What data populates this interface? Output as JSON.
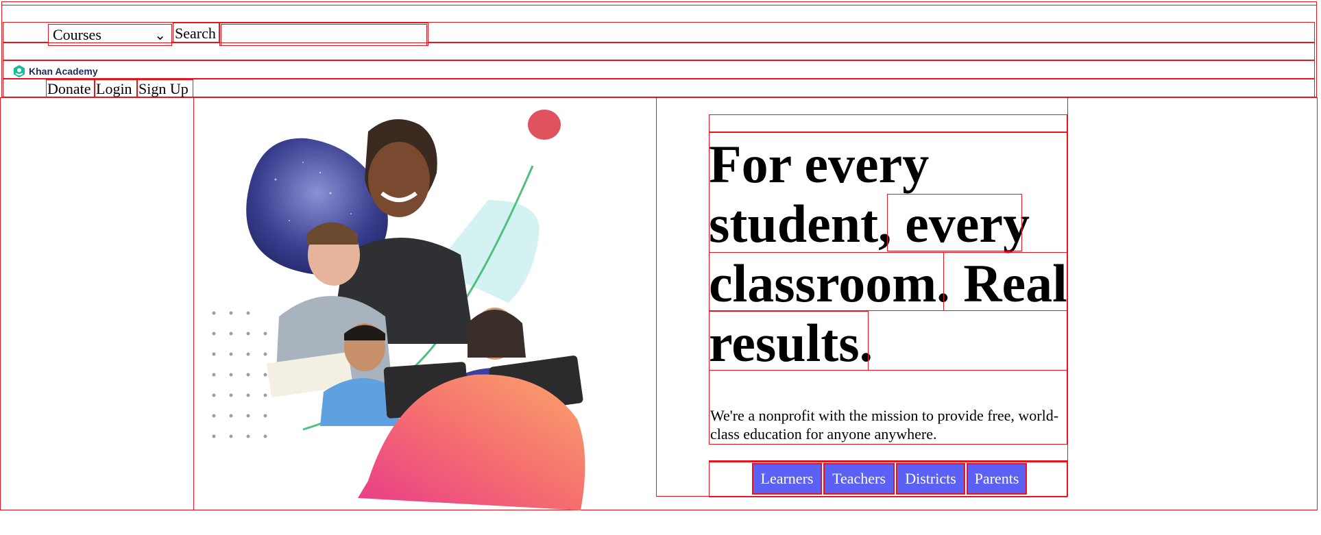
{
  "nav": {
    "courses_select": "Courses",
    "search_label": "Search",
    "search_value": "",
    "logo_text": "Khan Academy",
    "links": [
      "Donate",
      "Login",
      "Sign Up"
    ]
  },
  "hero": {
    "headline_parts": [
      "For every student,",
      "every classroom.",
      "Real results."
    ],
    "subtitle": "We're a nonprofit with the mission to provide free, world-class education for anyone anywhere.",
    "buttons": [
      "Learners",
      "Teachers",
      "Districts",
      "Parents"
    ]
  },
  "colors": {
    "cta_bg": "#5b61f4",
    "outline": "#e8141c",
    "logo": "#14bf96"
  }
}
